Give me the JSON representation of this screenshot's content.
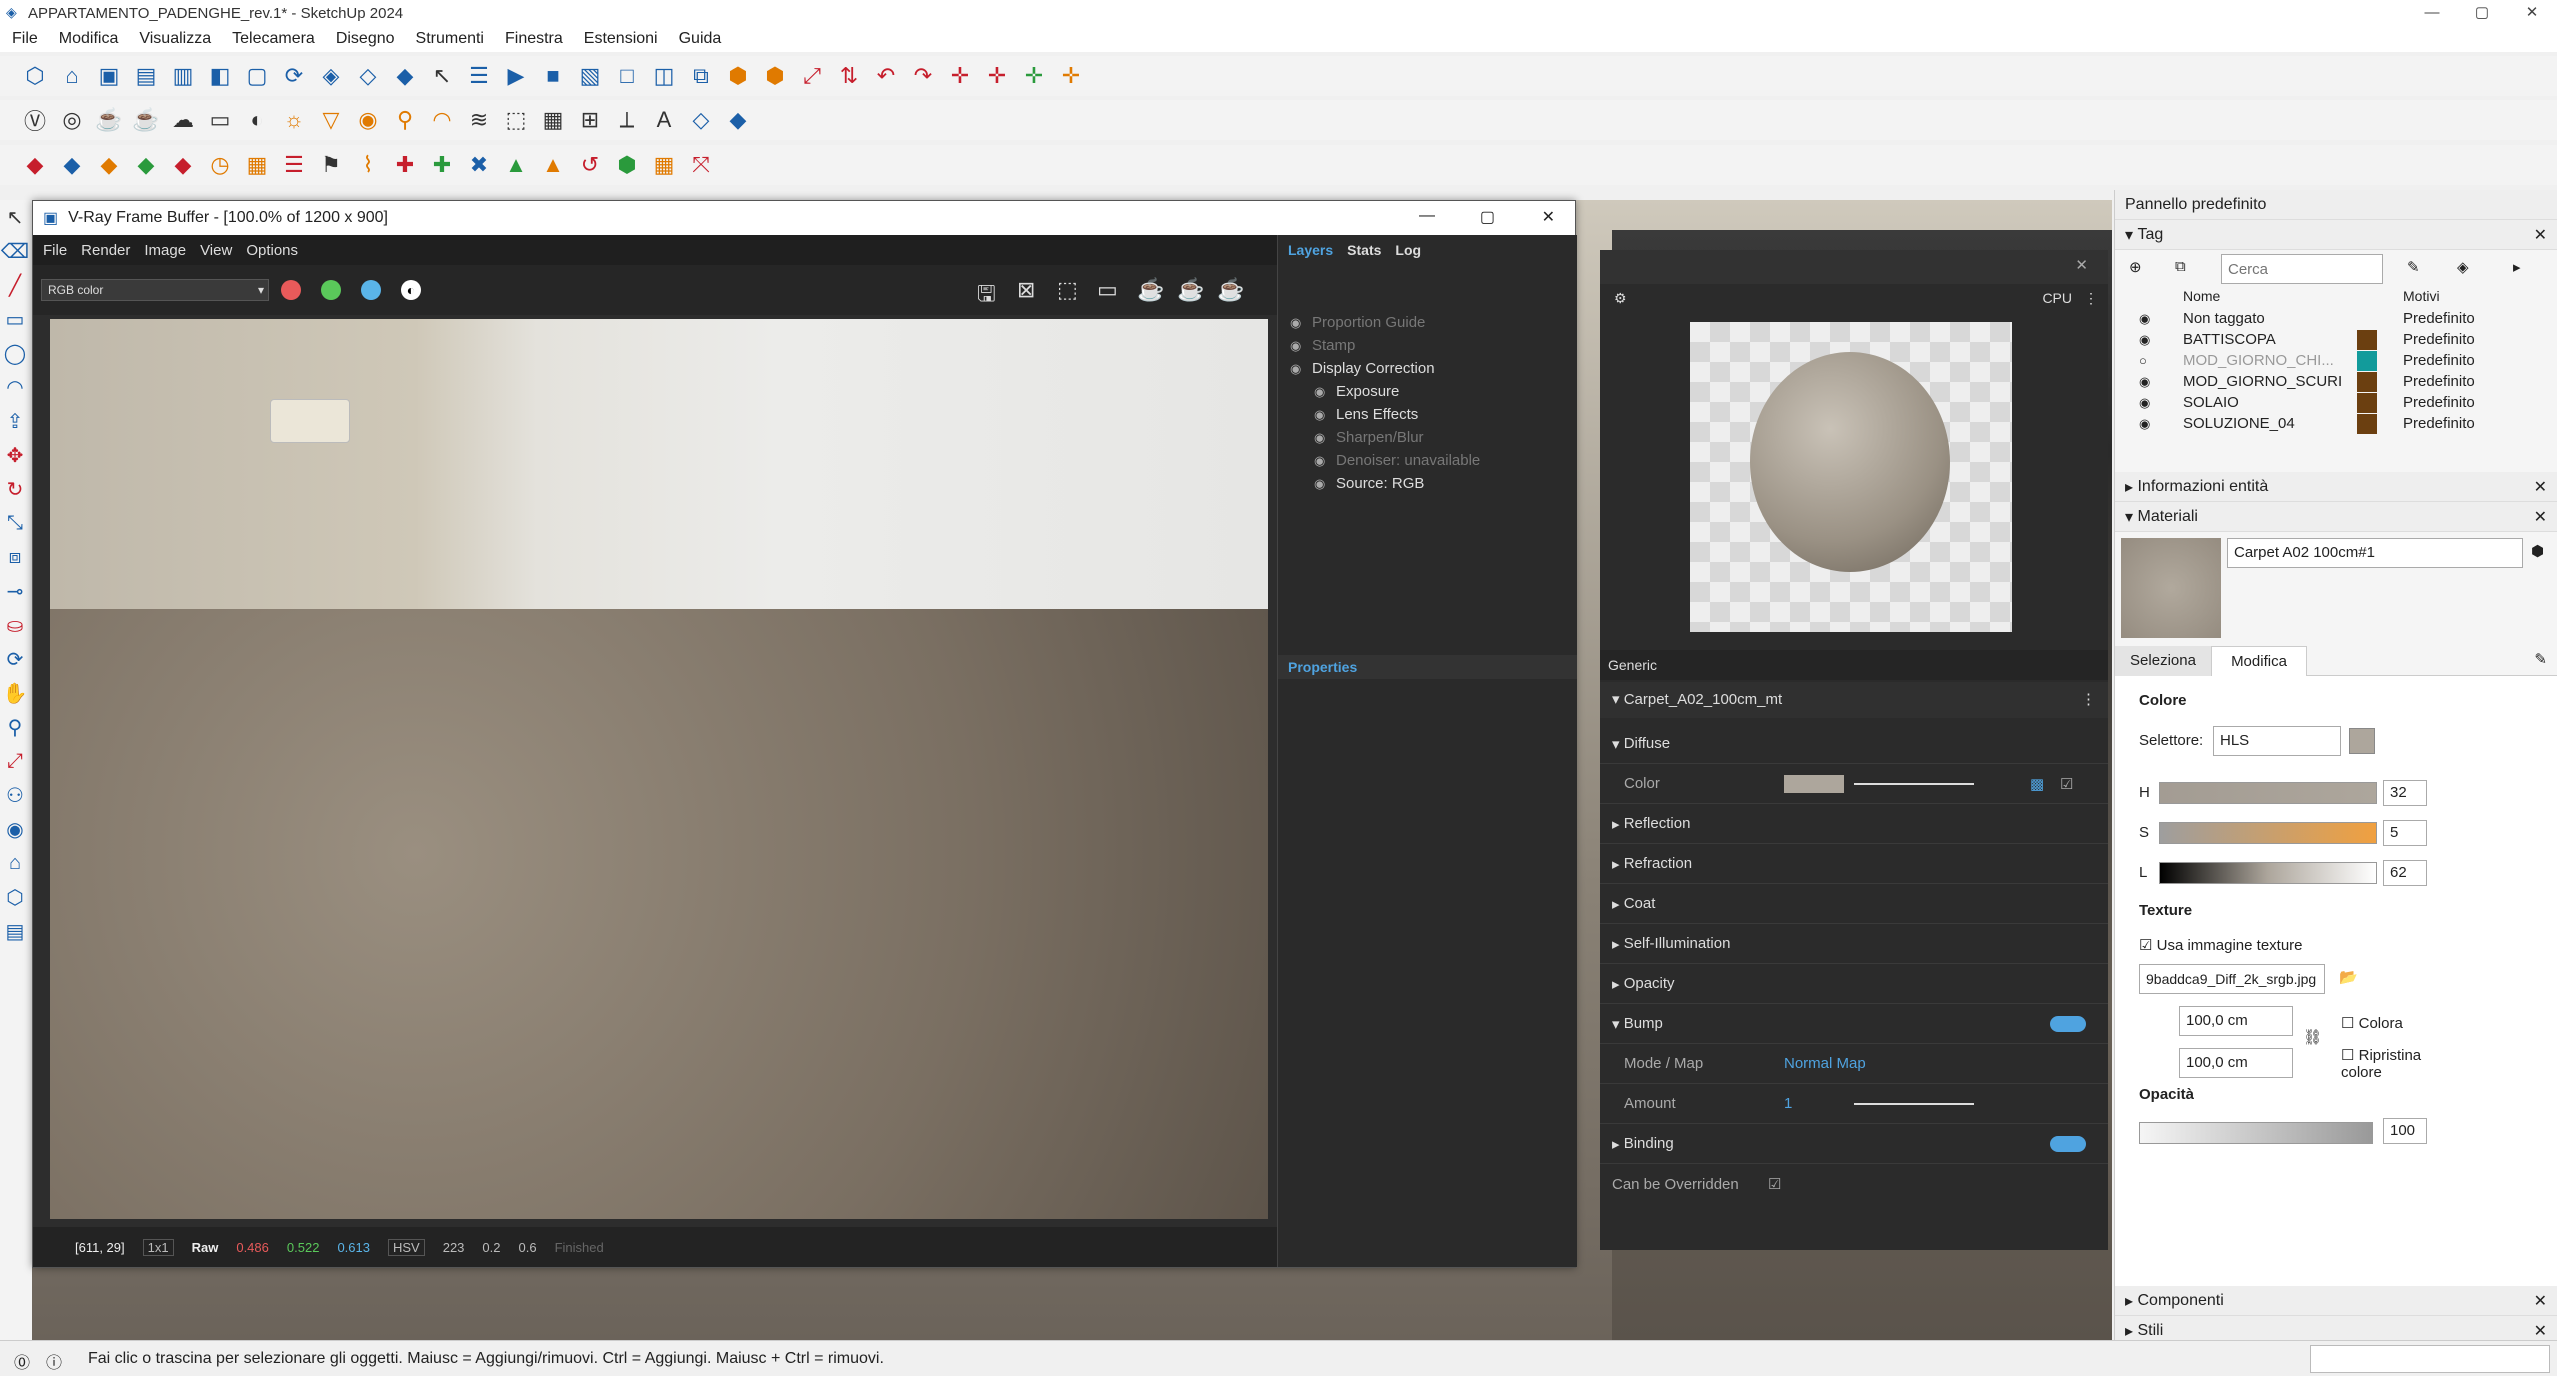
{
  "window": {
    "title": "APPARTAMENTO_PADENGHE_rev.1* - SketchUp 2024"
  },
  "menu": [
    "File",
    "Modifica",
    "Visualizza",
    "Telecamera",
    "Disegno",
    "Strumenti",
    "Finestra",
    "Estensioni",
    "Guida"
  ],
  "vfb": {
    "title": "V-Ray Frame Buffer - [100.0% of 1200 x 900]",
    "menu": [
      "File",
      "Render",
      "Image",
      "View",
      "Options"
    ],
    "channel": "RGB color",
    "layer_tabs": [
      "Layers",
      "Stats",
      "Log"
    ],
    "layers": [
      {
        "label": "Proportion Guide",
        "dim": true
      },
      {
        "label": "Stamp",
        "dim": true
      },
      {
        "label": "Display Correction",
        "dim": false
      },
      {
        "label": "Exposure",
        "dim": false
      },
      {
        "label": "Lens Effects",
        "dim": false
      },
      {
        "label": "Sharpen/Blur",
        "dim": true
      },
      {
        "label": "Denoiser: unavailable",
        "dim": true
      },
      {
        "label": "Source: RGB",
        "dim": false
      }
    ],
    "properties_label": "Properties",
    "status": {
      "coords": "[611, 29]",
      "zoom": "1x1",
      "raw": "Raw",
      "r": "0.486",
      "g": "0.522",
      "b": "0.613",
      "mode": "HSV",
      "h": "223",
      "s": "0.2",
      "v": "0.6",
      "state": "Finished"
    }
  },
  "vray_material": {
    "renderer": "CPU",
    "type": "Generic",
    "name": "Carpet_A02_100cm_mt",
    "sections": [
      "Diffuse",
      "Reflection",
      "Refraction",
      "Coat",
      "Self-Illumination",
      "Opacity",
      "Bump",
      "Binding"
    ],
    "color_label": "Color",
    "mode_map_label": "Mode / Map",
    "mode_map_value": "Normal Map",
    "amount_label": "Amount",
    "amount_value": "1",
    "overridden_label": "Can be Overridden"
  },
  "panel": {
    "title": "Pannello predefinito",
    "tag_header": "Tag",
    "search_placeholder": "Cerca",
    "col_name": "Nome",
    "col_pattern": "Motivi",
    "tags": [
      {
        "name": "Non taggato",
        "pattern": "Predefinito",
        "color": "",
        "visible": true
      },
      {
        "name": "BATTISCOPA",
        "pattern": "Predefinito",
        "color": "#6b3f10",
        "visible": true
      },
      {
        "name": "MOD_GIORNO_CHI...",
        "pattern": "Predefinito",
        "color": "#129b9b",
        "visible": false
      },
      {
        "name": "MOD_GIORNO_SCURI",
        "pattern": "Predefinito",
        "color": "#6b3f10",
        "visible": true
      },
      {
        "name": "SOLAIO",
        "pattern": "Predefinito",
        "color": "#6b3f10",
        "visible": true
      },
      {
        "name": "SOLUZIONE_04",
        "pattern": "Predefinito",
        "color": "#6b3f10",
        "visible": true
      }
    ],
    "entity_info": "Informazioni entità",
    "materials": "Materiali",
    "material_name": "Carpet A02 100cm#1",
    "tab_select": "Seleziona",
    "tab_edit": "Modifica",
    "color_header": "Colore",
    "selector_label": "Selettore:",
    "selector_value": "HLS",
    "h_label": "H",
    "h_value": "32",
    "s_label": "S",
    "s_value": "5",
    "l_label": "L",
    "l_value": "62",
    "texture_header": "Texture",
    "use_texture": "Usa immagine texture",
    "texture_file": "9baddca9_Diff_2k_srgb.jpg",
    "width": "100,0 cm",
    "height": "100,0 cm",
    "colorize": "Colora",
    "reset_color": "Ripristina colore",
    "opacity_header": "Opacità",
    "opacity_value": "100",
    "components": "Componenti",
    "styles": "Stili"
  },
  "statusbar": "Fai clic o trascina per selezionare gli oggetti. Maiusc = Aggiungi/rimuovi. Ctrl = Aggiungi. Maiusc + Ctrl = rimuovi."
}
